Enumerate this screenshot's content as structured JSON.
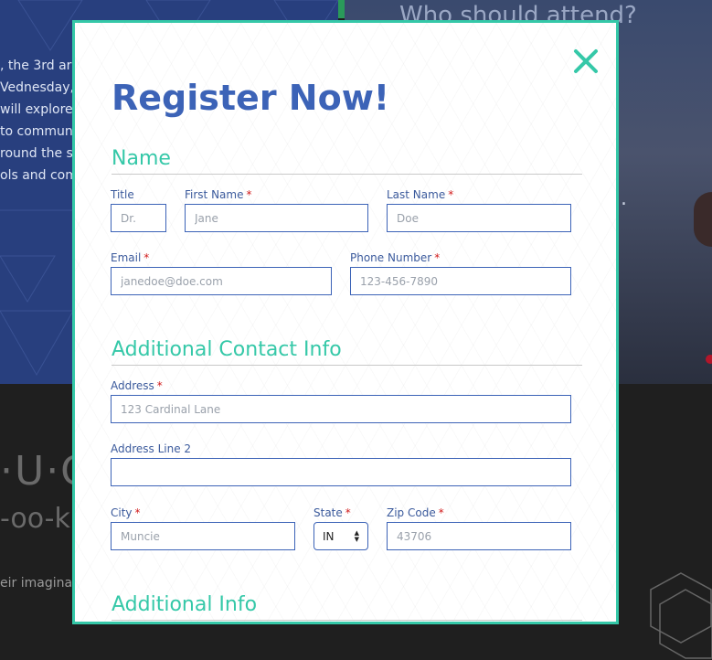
{
  "background": {
    "left_text_lines": [
      ", the 3rd ar",
      "Vednesday,",
      "will explore",
      "to commun",
      "round the s",
      "ols and com"
    ],
    "right_heading": "Who should attend?",
    "right_dot": ".",
    "brand_line_1": "·U·CA",
    "brand_line_2": "-oo-k",
    "bottom_text": "eir imaginat"
  },
  "modal": {
    "title": "Register Now!",
    "close_icon": "close-icon",
    "required_mark": "*",
    "sections": {
      "name": "Name",
      "contact": "Additional Contact Info",
      "info": "Additional Info"
    },
    "fields": {
      "title": {
        "label": "Title",
        "placeholder": "Dr."
      },
      "first_name": {
        "label": "First Name",
        "placeholder": "Jane"
      },
      "last_name": {
        "label": "Last Name",
        "placeholder": "Doe"
      },
      "email": {
        "label": "Email",
        "placeholder": "janedoe@doe.com"
      },
      "phone": {
        "label": "Phone Number",
        "placeholder": "123-456-7890"
      },
      "address": {
        "label": "Address",
        "placeholder": "123 Cardinal Lane"
      },
      "address2": {
        "label": "Address Line 2",
        "placeholder": ""
      },
      "city": {
        "label": "City",
        "placeholder": "Muncie"
      },
      "state": {
        "label": "State",
        "value": "IN"
      },
      "zip": {
        "label": "Zip Code",
        "placeholder": "43706"
      }
    }
  },
  "colors": {
    "accent": "#35c8a8",
    "brand_blue": "#3c63b7",
    "required": "#d01a1a"
  }
}
